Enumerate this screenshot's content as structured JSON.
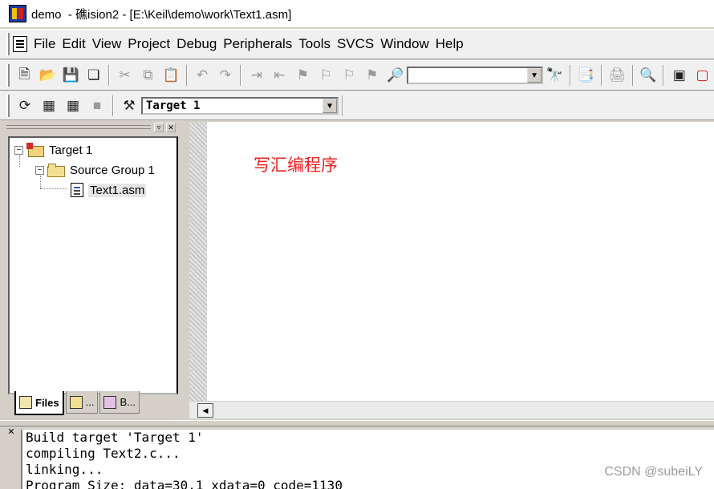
{
  "window": {
    "title": "demo  - 礁ision2 - [E:\\Keil\\demo\\work\\Text1.asm]"
  },
  "menu": {
    "items": [
      "File",
      "Edit",
      "View",
      "Project",
      "Debug",
      "Peripherals",
      "Tools",
      "SVCS",
      "Window",
      "Help"
    ]
  },
  "toolbar1": {
    "find_value": "",
    "icons": [
      "new-file-icon",
      "open-folder-icon",
      "save-icon",
      "save-all-icon",
      "cut-icon",
      "copy-icon",
      "paste-icon",
      "undo-icon",
      "redo-icon",
      "indent-icon",
      "unindent-icon",
      "bookmark-icon",
      "prev-bookmark-icon",
      "next-bookmark-icon",
      "clear-bookmarks-icon",
      "find-in-files-icon",
      "find-icon",
      "load-icon",
      "print-icon",
      "debug-icon",
      "window-layout-icon",
      "window-close-icon"
    ]
  },
  "toolbar2": {
    "target_select": "Target 1",
    "icons": [
      "translate-icon",
      "build-icon",
      "rebuild-icon",
      "stop-build-icon",
      "options-for-target-icon"
    ]
  },
  "project": {
    "root": "Target 1",
    "group": "Source Group 1",
    "file": "Text1.asm"
  },
  "tabs": {
    "files": "Files",
    "regs": "...",
    "books": "B..."
  },
  "editor": {
    "annotation": "写汇编程序"
  },
  "output": {
    "lines": [
      "Build target 'Target 1'",
      "compiling Text2.c...",
      "linking...",
      "Program Size: data=30.1 xdata=0 code=1130"
    ]
  },
  "watermark": "CSDN @subeiLY"
}
